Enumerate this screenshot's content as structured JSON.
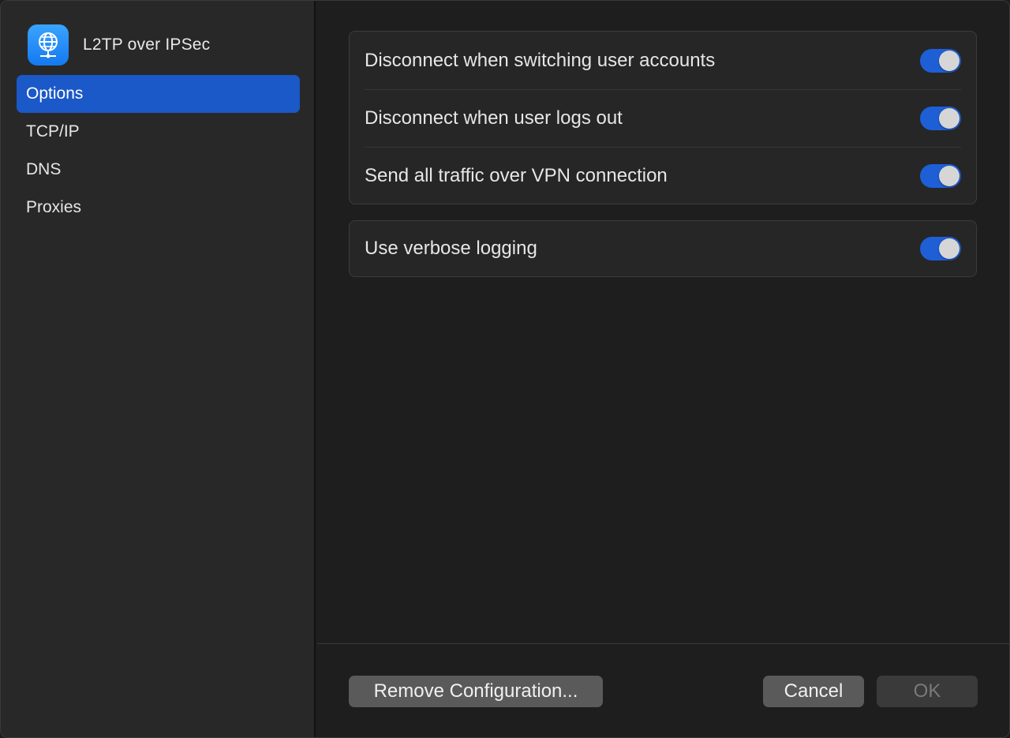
{
  "app": {
    "title": "L2TP over IPSec",
    "icon": "globe-network-icon",
    "accent_color": "#1b58c8"
  },
  "sidebar": {
    "items": [
      {
        "label": "Options",
        "selected": true
      },
      {
        "label": "TCP/IP",
        "selected": false
      },
      {
        "label": "DNS",
        "selected": false
      },
      {
        "label": "Proxies",
        "selected": false
      }
    ]
  },
  "settings": {
    "group1": [
      {
        "label": "Disconnect when switching user accounts",
        "on": true
      },
      {
        "label": "Disconnect when user logs out",
        "on": true
      },
      {
        "label": "Send all traffic over VPN connection",
        "on": true
      }
    ],
    "group2": [
      {
        "label": "Use verbose logging",
        "on": true
      }
    ]
  },
  "footer": {
    "remove_label": "Remove Configuration...",
    "cancel_label": "Cancel",
    "ok_label": "OK",
    "ok_enabled": false
  }
}
